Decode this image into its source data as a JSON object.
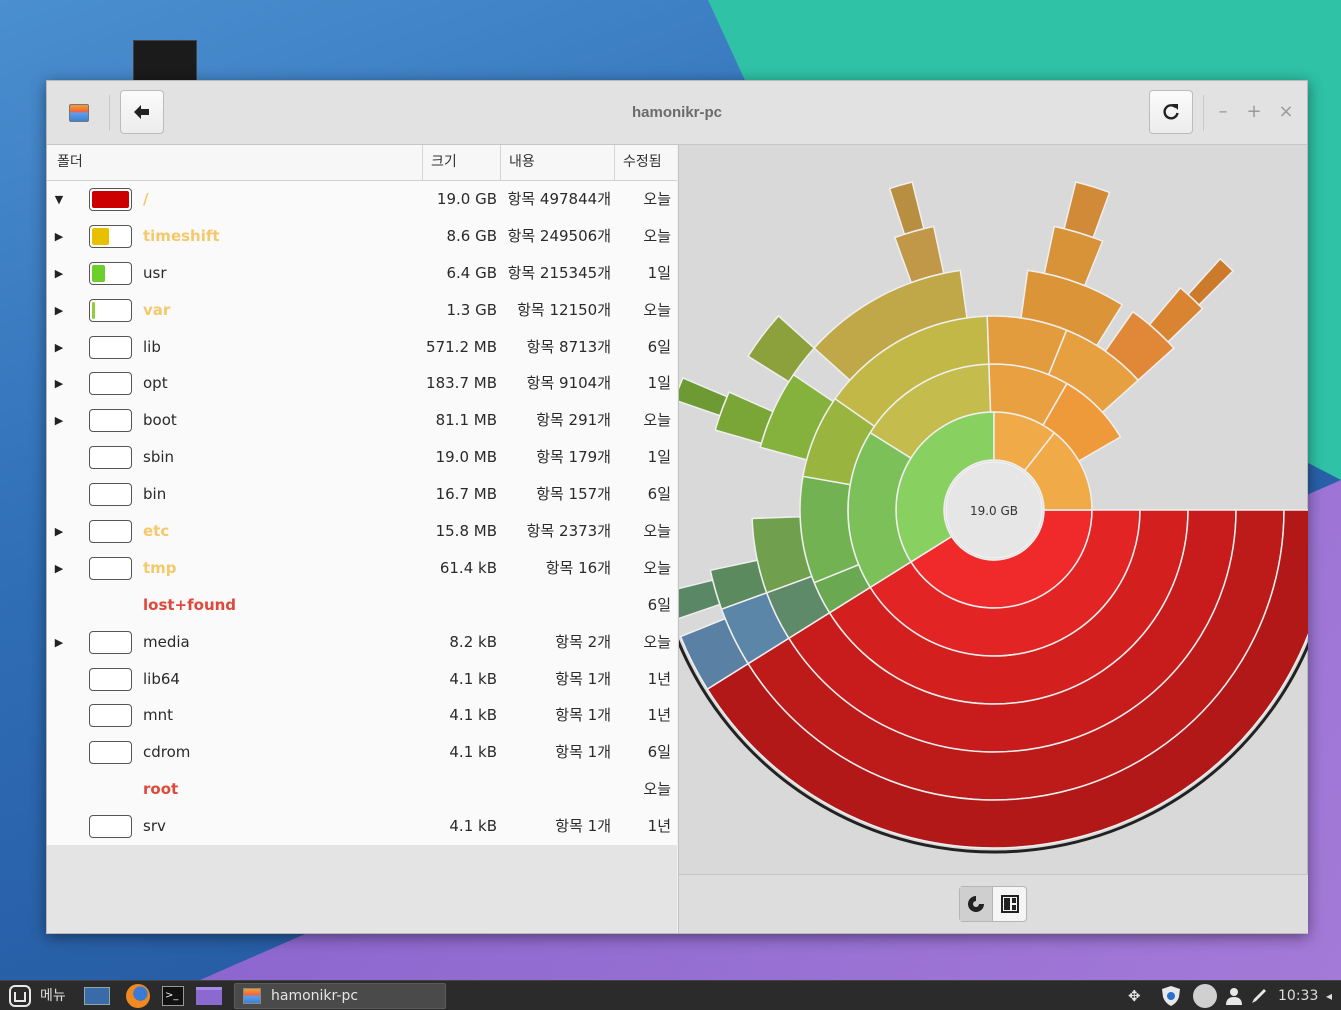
{
  "window": {
    "title": "hamonikr-pc"
  },
  "columns": {
    "folder": "폴더",
    "size": "크기",
    "contents": "내용",
    "modified": "수정됨"
  },
  "rows": [
    {
      "name": "/",
      "size": "19.0 GB",
      "items": "항목 497844개",
      "modified": "오늘",
      "expander": "down",
      "fill": 1.0,
      "fill_color": "#cc0000",
      "name_color": "#f5c86a",
      "has_bar": true
    },
    {
      "name": "timeshift",
      "size": "8.6 GB",
      "items": "항목 249506개",
      "modified": "오늘",
      "expander": "right",
      "fill": 0.45,
      "fill_color": "#e8c000",
      "name_color": "#f5c86a",
      "has_bar": true
    },
    {
      "name": "usr",
      "size": "6.4 GB",
      "items": "항목 215345개",
      "modified": "1일",
      "expander": "right",
      "fill": 0.34,
      "fill_color": "#6ccf2a",
      "name_color": "#2a2a2a",
      "has_bar": true
    },
    {
      "name": "var",
      "size": "1.3 GB",
      "items": "항목 12150개",
      "modified": "오늘",
      "expander": "right",
      "fill": 0.07,
      "fill_color": "#8fcf3a",
      "name_color": "#f5c86a",
      "has_bar": true
    },
    {
      "name": "lib",
      "size": "571.2 MB",
      "items": "항목 8713개",
      "modified": "6일",
      "expander": "right",
      "fill": 0,
      "fill_color": "#8fcf3a",
      "name_color": "#2a2a2a",
      "has_bar": true
    },
    {
      "name": "opt",
      "size": "183.7 MB",
      "items": "항목 9104개",
      "modified": "1일",
      "expander": "right",
      "fill": 0,
      "fill_color": "#8fcf3a",
      "name_color": "#2a2a2a",
      "has_bar": true
    },
    {
      "name": "boot",
      "size": "81.1 MB",
      "items": "항목 291개",
      "modified": "오늘",
      "expander": "right",
      "fill": 0,
      "fill_color": "#8fcf3a",
      "name_color": "#2a2a2a",
      "has_bar": true
    },
    {
      "name": "sbin",
      "size": "19.0 MB",
      "items": "항목 179개",
      "modified": "1일",
      "expander": "",
      "fill": 0,
      "fill_color": "#8fcf3a",
      "name_color": "#2a2a2a",
      "has_bar": true
    },
    {
      "name": "bin",
      "size": "16.7 MB",
      "items": "항목 157개",
      "modified": "6일",
      "expander": "",
      "fill": 0,
      "fill_color": "#8fcf3a",
      "name_color": "#2a2a2a",
      "has_bar": true
    },
    {
      "name": "etc",
      "size": "15.8 MB",
      "items": "항목 2373개",
      "modified": "오늘",
      "expander": "right",
      "fill": 0,
      "fill_color": "#8fcf3a",
      "name_color": "#f5c86a",
      "has_bar": true
    },
    {
      "name": "tmp",
      "size": "61.4 kB",
      "items": "항목 16개",
      "modified": "오늘",
      "expander": "right",
      "fill": 0,
      "fill_color": "#8fcf3a",
      "name_color": "#f5c86a",
      "has_bar": true
    },
    {
      "name": "lost+found",
      "size": "",
      "items": "",
      "modified": "6일",
      "expander": "",
      "fill": 0,
      "fill_color": "#8fcf3a",
      "name_color": "#e0483a",
      "has_bar": false
    },
    {
      "name": "media",
      "size": "8.2 kB",
      "items": "항목 2개",
      "modified": "오늘",
      "expander": "right",
      "fill": 0,
      "fill_color": "#8fcf3a",
      "name_color": "#2a2a2a",
      "has_bar": true
    },
    {
      "name": "lib64",
      "size": "4.1 kB",
      "items": "항목 1개",
      "modified": "1년",
      "expander": "",
      "fill": 0,
      "fill_color": "#8fcf3a",
      "name_color": "#2a2a2a",
      "has_bar": true
    },
    {
      "name": "mnt",
      "size": "4.1 kB",
      "items": "항목 1개",
      "modified": "1년",
      "expander": "",
      "fill": 0,
      "fill_color": "#8fcf3a",
      "name_color": "#2a2a2a",
      "has_bar": true
    },
    {
      "name": "cdrom",
      "size": "4.1 kB",
      "items": "항목 1개",
      "modified": "6일",
      "expander": "",
      "fill": 0,
      "fill_color": "#8fcf3a",
      "name_color": "#2a2a2a",
      "has_bar": true
    },
    {
      "name": "root",
      "size": "",
      "items": "",
      "modified": "오늘",
      "expander": "",
      "fill": 0,
      "fill_color": "#8fcf3a",
      "name_color": "#e0483a",
      "has_bar": false
    },
    {
      "name": "srv",
      "size": "4.1 kB",
      "items": "항목 1개",
      "modified": "1년",
      "expander": "",
      "fill": 0,
      "fill_color": "#8fcf3a",
      "name_color": "#2a2a2a",
      "has_bar": true
    }
  ],
  "chart": {
    "center_label": "19.0 GB"
  },
  "taskbar": {
    "menu_label": "메뉴",
    "window_button": "hamonikr-pc",
    "clock": "10:33"
  },
  "colors": {
    "accent_red": "#cc0000",
    "warning": "#f5c86a",
    "error": "#e0483a"
  }
}
